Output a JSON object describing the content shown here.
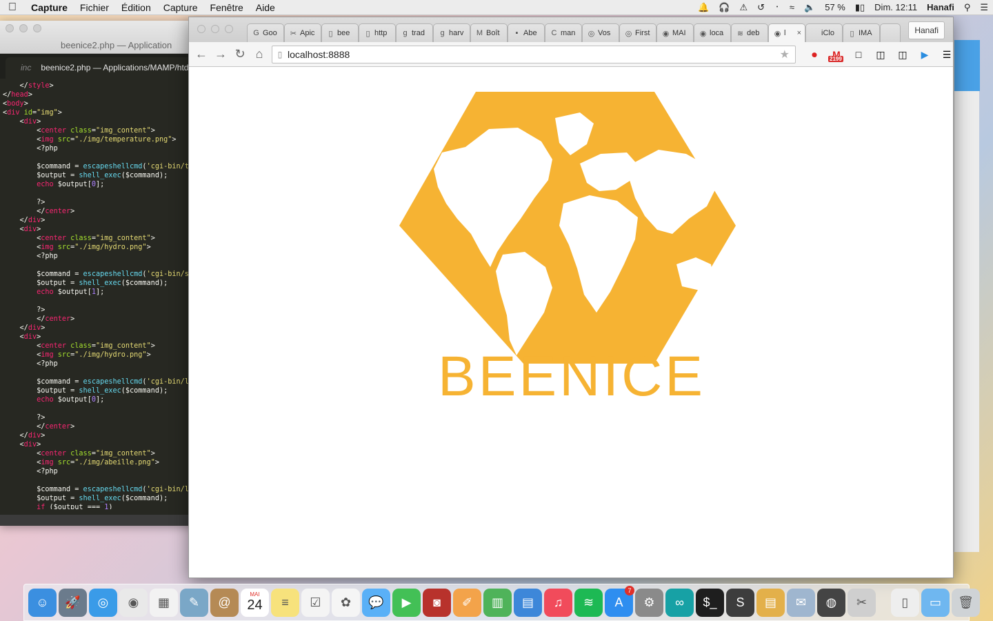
{
  "menubar": {
    "app": "Capture",
    "items": [
      "Fichier",
      "Édition",
      "Capture",
      "Fenêtre",
      "Aide"
    ],
    "battery": "57 %",
    "clock": "Dim. 12:11",
    "user": "Hanafi"
  },
  "editor": {
    "window_title": "beenice2.php — Application",
    "tab_tag": "inc",
    "tab_title": "beenice2.php — Applications/MAMP/htd"
  },
  "browser": {
    "profile": "Hanafi",
    "url": "localhost:8888",
    "gmail_badge": "2199",
    "tabs": [
      {
        "label": "Goo",
        "icon": "G"
      },
      {
        "label": "Apic",
        "icon": "✂"
      },
      {
        "label": "bee",
        "icon": "▯"
      },
      {
        "label": "http",
        "icon": "▯"
      },
      {
        "label": "trad",
        "icon": "g"
      },
      {
        "label": "harv",
        "icon": "g"
      },
      {
        "label": "Boît",
        "icon": "M"
      },
      {
        "label": "Abe",
        "icon": "▪"
      },
      {
        "label": "man",
        "icon": "C"
      },
      {
        "label": "Vos",
        "icon": "◎"
      },
      {
        "label": "First",
        "icon": "◎"
      },
      {
        "label": "MAI",
        "icon": "◉"
      },
      {
        "label": "loca",
        "icon": "◉"
      },
      {
        "label": "deb",
        "icon": "≋"
      },
      {
        "label": "l",
        "icon": "◉",
        "active": true
      },
      {
        "label": "iClo",
        "icon": ""
      },
      {
        "label": "IMA",
        "icon": "▯"
      }
    ],
    "logo_text": "BEENICE",
    "logo_color": "#f6b333"
  },
  "dock": {
    "calendar_day": "24",
    "calendar_month": "MAI",
    "appstore_badge": "7",
    "apps": [
      "finder",
      "launchpad",
      "safari",
      "chrome",
      "grid",
      "preview",
      "contacts",
      "calendar",
      "notes",
      "reminders",
      "photos",
      "messages",
      "facetime",
      "photobooth",
      "pages",
      "numbers",
      "keynote",
      "itunes",
      "spotify",
      "appstore",
      "syspref",
      "arduino",
      "terminal",
      "sublime",
      "logs",
      "mail-compose",
      "github",
      "xcode-tool",
      "archive",
      "folder",
      "trash"
    ]
  }
}
